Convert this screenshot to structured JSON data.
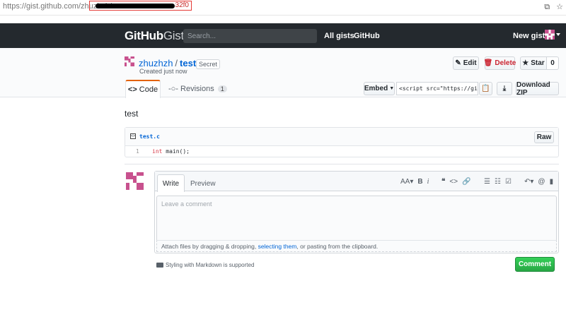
{
  "browser": {
    "url_prefix": "https://gist.github.com/zhuzhzh/",
    "url_tail": "32f0",
    "icons": [
      "translate-icon",
      "bookmark-icon"
    ]
  },
  "header": {
    "logo_bold": "GitHub",
    "logo_light": "Gist",
    "search_placeholder": "Search...",
    "nav_all": "All gists",
    "nav_github": "GitHub",
    "new_gist": "New gist"
  },
  "gist": {
    "owner": "zhuzhzh",
    "separator": "/",
    "filename": "test.c",
    "secret_badge": "Secret",
    "created": "Created just now",
    "edit_label": "Edit",
    "delete_label": "Delete",
    "star_label": "Star",
    "star_count": "0",
    "tab_code": "Code",
    "tab_revisions": "Revisions",
    "revisions_count": "1",
    "embed_label": "Embed",
    "embed_value": "<script src=\"https://gist.",
    "download_zip": "Download ZIP",
    "description": "test"
  },
  "file": {
    "name": "test.c",
    "raw_label": "Raw",
    "line_number": "1",
    "code_keyword": "int",
    "code_rest": " main();"
  },
  "comment": {
    "tab_write": "Write",
    "tab_preview": "Preview",
    "placeholder": "Leave a comment",
    "attach_prefix": "Attach files by dragging & dropping, ",
    "attach_link": "selecting them",
    "attach_suffix": ", or pasting from the clipboard.",
    "markdown_note": "Styling with Markdown is supported",
    "submit_label": "Comment"
  },
  "colors": {
    "header_bg": "#24292e",
    "link": "#0366d6",
    "active_tab": "#e36209",
    "comment_button": "#28a745",
    "delete": "#cb2431",
    "avatar_pink": "#c8518e"
  }
}
